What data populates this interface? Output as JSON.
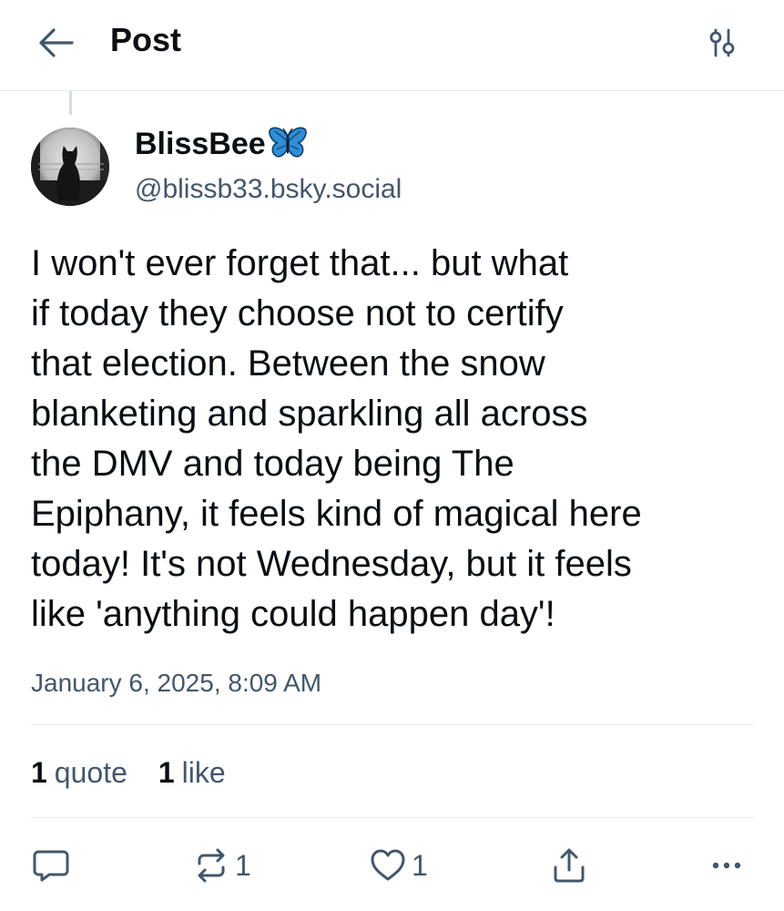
{
  "header": {
    "title": "Post"
  },
  "author": {
    "display_name": "BlissBee",
    "emoji": "butterfly",
    "handle": "@blissb33.bsky.social"
  },
  "post": {
    "text": "I won't ever forget that... but what\nif today they choose not to certify\nthat election. Between the snow\nblanketing and sparkling all across\nthe DMV and today being The\nEpiphany, it feels kind of magical here\ntoday! It's not Wednesday, but it feels\nlike 'anything could happen day'!",
    "timestamp": "January 6, 2025, 8:09 AM"
  },
  "stats": {
    "quotes_count": "1",
    "quotes_label": "quote",
    "likes_count": "1",
    "likes_label": "like"
  },
  "actions": {
    "reply_icon": "reply-icon",
    "repost_icon": "repost-icon",
    "repost_count": "1",
    "like_icon": "heart-icon",
    "like_count": "1",
    "share_icon": "share-icon",
    "more_icon": "more-icon"
  },
  "colors": {
    "text_primary": "#0b0f14",
    "text_secondary": "#42576c",
    "accent": "#2a5a8c",
    "divider": "#e6e9ee"
  }
}
